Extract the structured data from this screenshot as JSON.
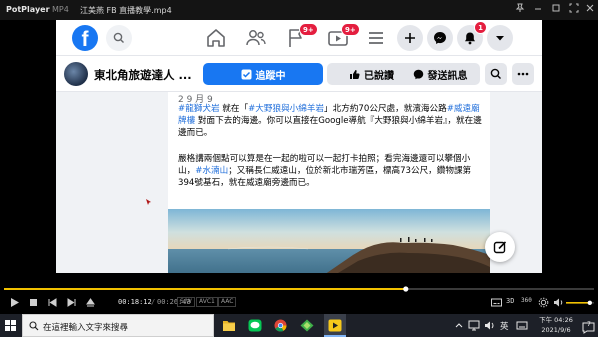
{
  "player": {
    "app_name": "PotPlayer",
    "format": "MP4",
    "file_name": "江美燕 FB 直播教學.mp4",
    "time_current": "00:18:12",
    "time_total": "00:26:43",
    "badges": [
      "S/W",
      "AVC1",
      "AAC"
    ],
    "progress_fraction": 0.681,
    "volume_fraction": 0.85,
    "right_labels": {
      "three_d": "3D",
      "three_sixty": "360"
    }
  },
  "facebook": {
    "logo_letter": "f",
    "badges": {
      "flag": "9+",
      "video": "9+",
      "notifications": "1"
    },
    "page": {
      "name": "東北角旅遊達人 ...",
      "follow_label": "追蹤中",
      "liked_label": "已說讚",
      "message_label": "發送訊息"
    },
    "post": {
      "author_fragment": "2 9 月 9",
      "paragraph1": [
        {
          "text": "#龍獅犬岩",
          "tag": true
        },
        {
          "text": " 就在「",
          "tag": false
        },
        {
          "text": "#大野狼與小綿羊岩",
          "tag": true
        },
        {
          "text": "」北方約70公尺處，就濱海公路",
          "tag": false
        },
        {
          "text": "#威遠廟牌樓",
          "tag": true
        },
        {
          "text": " 對面下去的海邊。你可以直接在Google導航『大野狼與小綿羊岩』，就在邊邊而已。",
          "tag": false
        }
      ],
      "paragraph2": [
        {
          "text": "嚴格講兩個點可以算是在一起的啦可以一起打卡拍照；看完海邊還可以攀個小山，",
          "tag": false
        },
        {
          "text": "#水湳山",
          "tag": true
        },
        {
          "text": "；又稱長仁威遠山，位於新北市瑞芳區，標高73公尺，鑽物課第394號基石，就在威遠廟旁邊而已。",
          "tag": false
        }
      ]
    }
  },
  "taskbar": {
    "search_placeholder": "在這裡輸入文字來搜尋",
    "ime_label": "英",
    "time": "下午 04:26",
    "date": "2021/9/6",
    "notification_count": "7"
  },
  "colors": {
    "fb_blue": "#1877f2",
    "hashtag": "#216fdb",
    "badge_red": "#e41e3f",
    "seek_yellow": "#f2c200"
  }
}
